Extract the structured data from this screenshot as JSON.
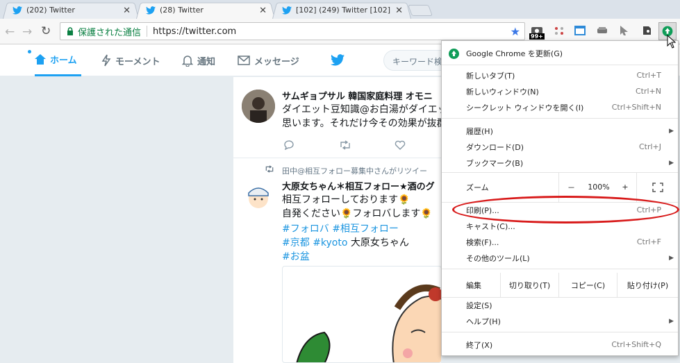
{
  "tabs": [
    {
      "title": "(202) Twitter",
      "active": false
    },
    {
      "title": "(28) Twitter",
      "active": true
    },
    {
      "title": "[102] (249) Twitter [102]",
      "active": false
    }
  ],
  "omnibox": {
    "security_label": "保護された通信",
    "url": "https://twitter.com"
  },
  "extension_badge": "99+",
  "twitter_nav": {
    "home": "ホーム",
    "moments": "モーメント",
    "notifications": "通知",
    "messages": "メッセージ",
    "search_placeholder": "キーワード検"
  },
  "tweets": [
    {
      "name": "サムギョプサル 韓国家庭料理 オモニ",
      "lines": [
        "ダイエット豆知識@お白湯がダイエッ",
        "思います。それだけ今その効果が抜群"
      ]
    },
    {
      "retweet_by": "田中@相互フォロー募集中さんがリツイー",
      "name": "大原女ちゃん＊相互フォロー★酒のグ",
      "lines": [
        "相互フォローしております🌻",
        "自発ください🌻フォロバします🌻"
      ],
      "hashtags": [
        "#フォロバ",
        "#相互フォロー",
        "#京都",
        "#kyoto",
        "#お盆"
      ],
      "trailing_text": "大原女ちゃん"
    }
  ],
  "menu": {
    "update": "Google Chrome を更新(G)",
    "new_tab": {
      "label": "新しいタブ(T)",
      "shortcut": "Ctrl+T"
    },
    "new_window": {
      "label": "新しいウィンドウ(N)",
      "shortcut": "Ctrl+N"
    },
    "incognito": {
      "label": "シークレット ウィンドウを開く(I)",
      "shortcut": "Ctrl+Shift+N"
    },
    "history": {
      "label": "履歴(H)"
    },
    "downloads": {
      "label": "ダウンロード(D)",
      "shortcut": "Ctrl+J"
    },
    "bookmarks": {
      "label": "ブックマーク(B)"
    },
    "zoom": {
      "label": "ズーム",
      "minus": "－",
      "value": "100%",
      "plus": "+"
    },
    "print": {
      "label": "印刷(P)...",
      "shortcut": "Ctrl+P"
    },
    "cast": {
      "label": "キャスト(C)..."
    },
    "find": {
      "label": "検索(F)...",
      "shortcut": "Ctrl+F"
    },
    "more_tools": {
      "label": "その他のツール(L)"
    },
    "edit": {
      "label": "編集",
      "cut": "切り取り(T)",
      "copy": "コピー(C)",
      "paste": "貼り付け(P)"
    },
    "settings": {
      "label": "設定(S)"
    },
    "help": {
      "label": "ヘルプ(H)"
    },
    "exit": {
      "label": "終了(X)",
      "shortcut": "Ctrl+Shift+Q"
    }
  },
  "colors": {
    "twitter_blue": "#1da1f2",
    "secure_green": "#0b8043",
    "update_green": "#0f9d58",
    "highlight_red": "#d81a1a"
  }
}
